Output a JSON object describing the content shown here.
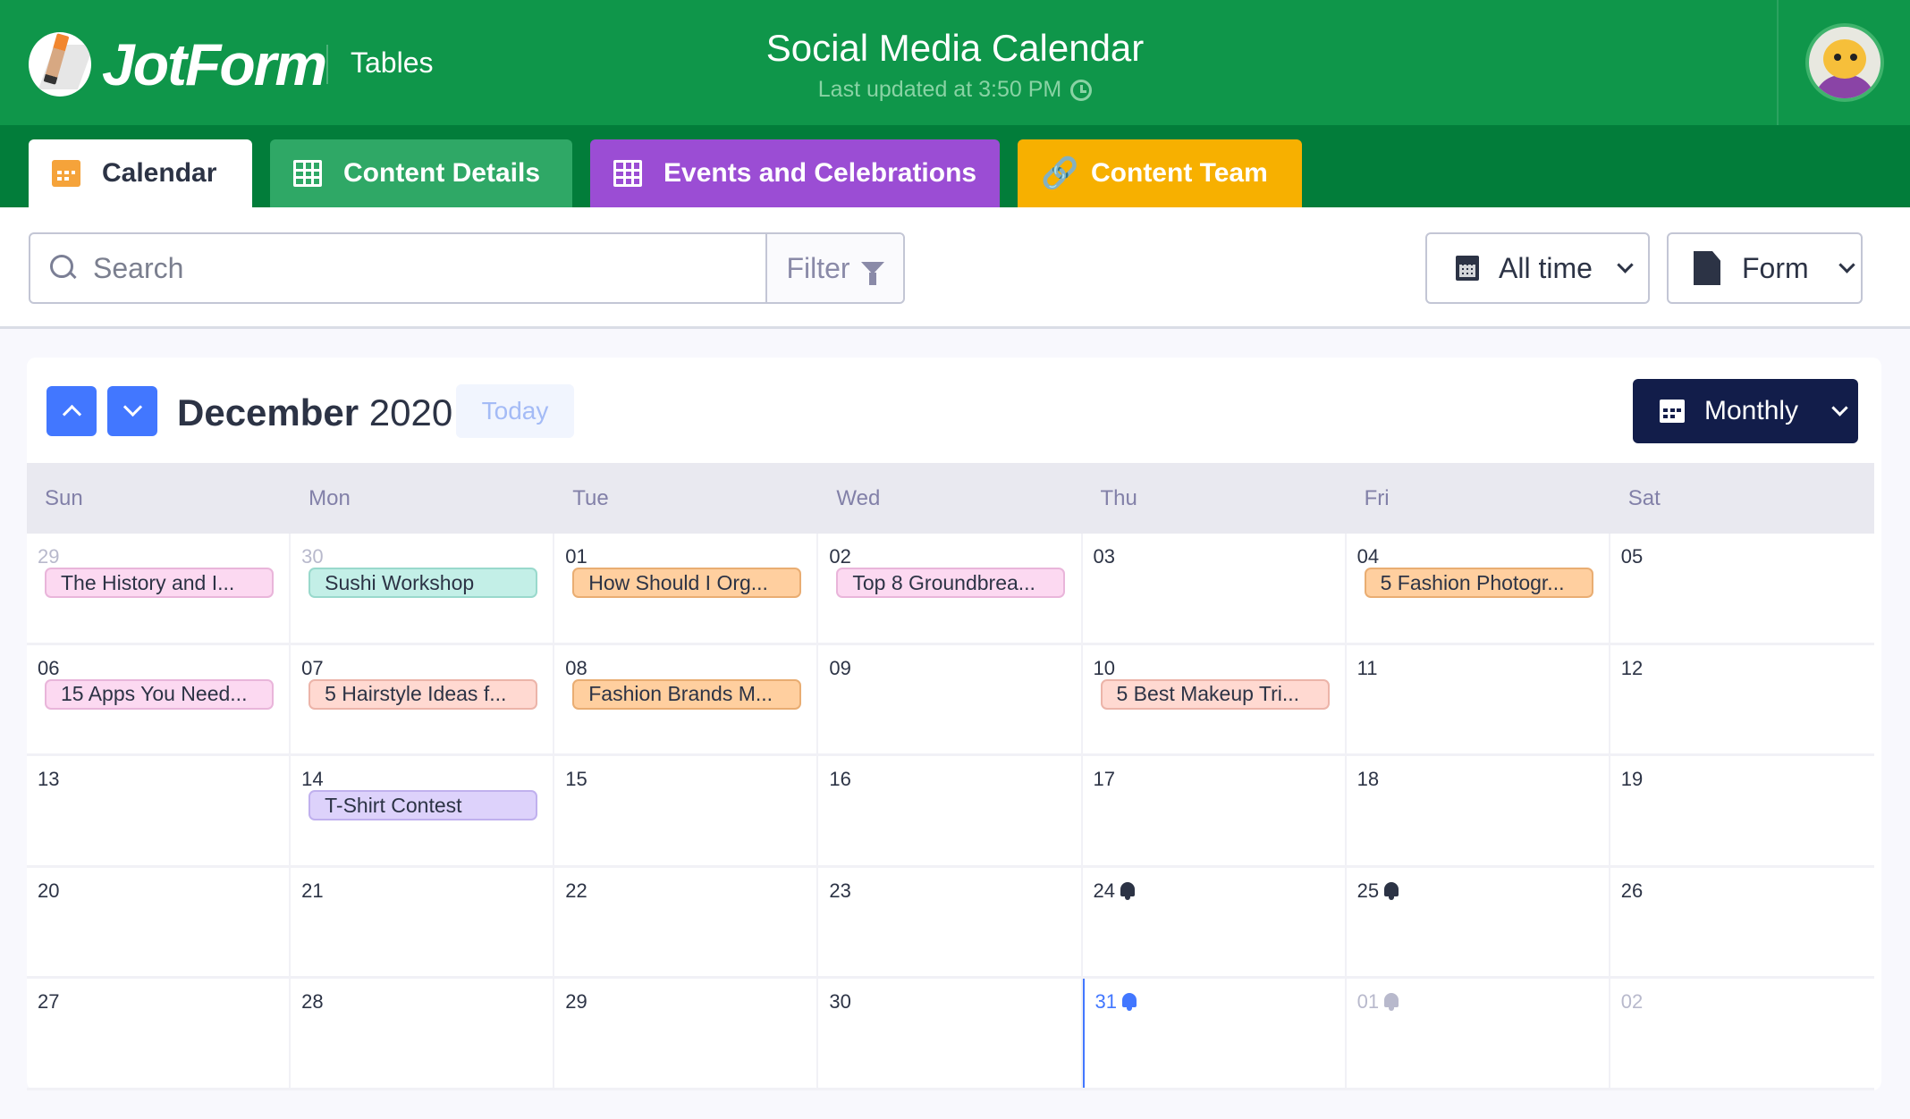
{
  "header": {
    "brand": "JotForm",
    "app_name": "Tables",
    "title": "Social Media Calendar",
    "subtitle": "Last updated at 3:50 PM",
    "avatar_icon": "user-avatar"
  },
  "tabs": [
    {
      "label": "Calendar",
      "icon": "calendar-icon",
      "color": "#ffffff",
      "active": true
    },
    {
      "label": "Content Details",
      "icon": "table-grid-icon",
      "color": "#2fa866",
      "active": false
    },
    {
      "label": "Events and Celebrations",
      "icon": "table-grid-icon",
      "color": "#9b4dd4",
      "active": false
    },
    {
      "label": "Content Team",
      "icon": "link-icon",
      "color": "#f7b000",
      "active": false
    }
  ],
  "toolbar": {
    "search_placeholder": "Search",
    "search_value": "",
    "filter_label": "Filter",
    "time_range": "All time",
    "form_label": "Form"
  },
  "calendar": {
    "month": "December",
    "year": "2020",
    "today_label": "Today",
    "view_label": "Monthly",
    "days_of_week": [
      "Sun",
      "Mon",
      "Tue",
      "Wed",
      "Thu",
      "Fri",
      "Sat"
    ],
    "weeks": [
      [
        {
          "num": "29",
          "other": true,
          "event": {
            "title": "The History and I...",
            "style": "pink"
          }
        },
        {
          "num": "30",
          "other": true,
          "event": {
            "title": "Sushi Workshop",
            "style": "teal"
          }
        },
        {
          "num": "01",
          "event": {
            "title": "How Should I Org...",
            "style": "orange"
          }
        },
        {
          "num": "02",
          "event": {
            "title": "Top 8 Groundbrea...",
            "style": "pink"
          }
        },
        {
          "num": "03"
        },
        {
          "num": "04",
          "event": {
            "title": "5 Fashion Photogr...",
            "style": "orange"
          }
        },
        {
          "num": "05"
        }
      ],
      [
        {
          "num": "06",
          "event": {
            "title": "15 Apps You Need...",
            "style": "pink"
          }
        },
        {
          "num": "07",
          "event": {
            "title": "5 Hairstyle Ideas f...",
            "style": "salmon"
          }
        },
        {
          "num": "08",
          "event": {
            "title": "Fashion Brands M...",
            "style": "orange"
          }
        },
        {
          "num": "09"
        },
        {
          "num": "10",
          "event": {
            "title": "5 Best Makeup Tri...",
            "style": "salmon"
          }
        },
        {
          "num": "11"
        },
        {
          "num": "12"
        }
      ],
      [
        {
          "num": "13"
        },
        {
          "num": "14",
          "event": {
            "title": "T-Shirt Contest",
            "style": "purple"
          }
        },
        {
          "num": "15"
        },
        {
          "num": "16"
        },
        {
          "num": "17"
        },
        {
          "num": "18"
        },
        {
          "num": "19"
        }
      ],
      [
        {
          "num": "20"
        },
        {
          "num": "21"
        },
        {
          "num": "22"
        },
        {
          "num": "23"
        },
        {
          "num": "24",
          "bell": true
        },
        {
          "num": "25",
          "bell": true
        },
        {
          "num": "26"
        }
      ],
      [
        {
          "num": "27"
        },
        {
          "num": "28"
        },
        {
          "num": "29"
        },
        {
          "num": "30"
        },
        {
          "num": "31",
          "bell": true,
          "today": true
        },
        {
          "num": "01",
          "bell": true,
          "other": true
        },
        {
          "num": "02",
          "other": true
        }
      ]
    ]
  }
}
